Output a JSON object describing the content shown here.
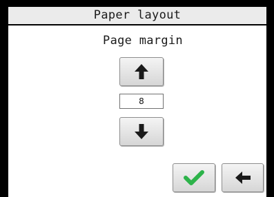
{
  "window": {
    "title": "Paper layout"
  },
  "setting": {
    "label": "Page margin",
    "value": "8"
  },
  "icons": {
    "increase": "arrow-up-icon",
    "decrease": "arrow-down-icon",
    "confirm": "checkmark-icon",
    "back": "arrow-left-icon"
  },
  "colors": {
    "confirm_check": "#2db34a",
    "arrow": "#1a1a1a",
    "title_bar": "#ebebeb"
  }
}
